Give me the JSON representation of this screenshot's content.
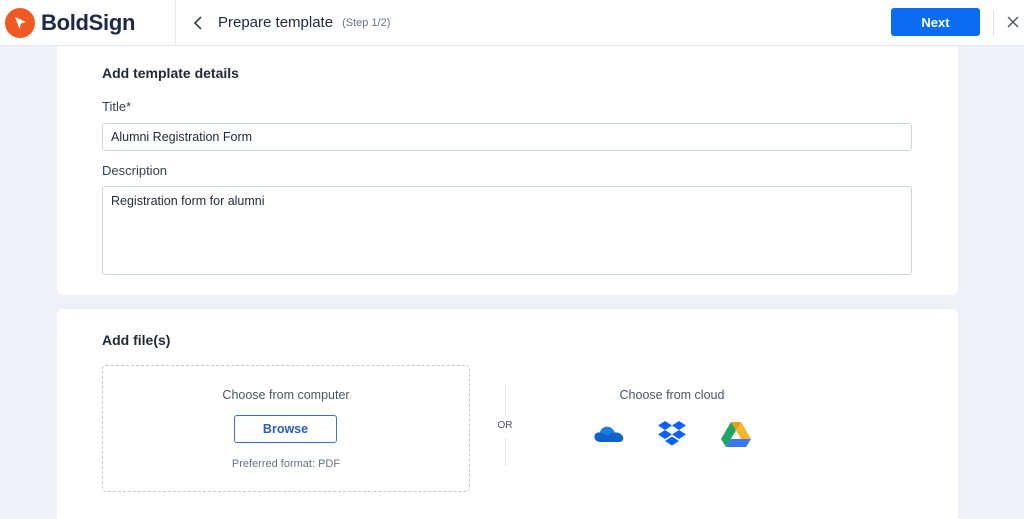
{
  "header": {
    "brand": "BoldSign",
    "page_title": "Prepare template",
    "step": "(Step 1/2)",
    "next_label": "Next",
    "back_icon": "chevron-left-icon",
    "close_icon": "close-icon"
  },
  "details": {
    "heading": "Add template details",
    "title_label": "Title*",
    "title_value": "Alumni Registration Form",
    "description_label": "Description",
    "description_value": "Registration form for alumni"
  },
  "files": {
    "heading": "Add file(s)",
    "computer_title": "Choose from computer",
    "browse_label": "Browse",
    "preferred_format": "Preferred format: PDF",
    "or_label": "OR",
    "cloud_title": "Choose from cloud",
    "cloud_providers": [
      "onedrive-icon",
      "dropbox-icon",
      "google-drive-icon"
    ]
  },
  "colors": {
    "brand_orange": "#f05a22",
    "primary_blue": "#0a6cf2",
    "page_background": "#eef1f7"
  }
}
